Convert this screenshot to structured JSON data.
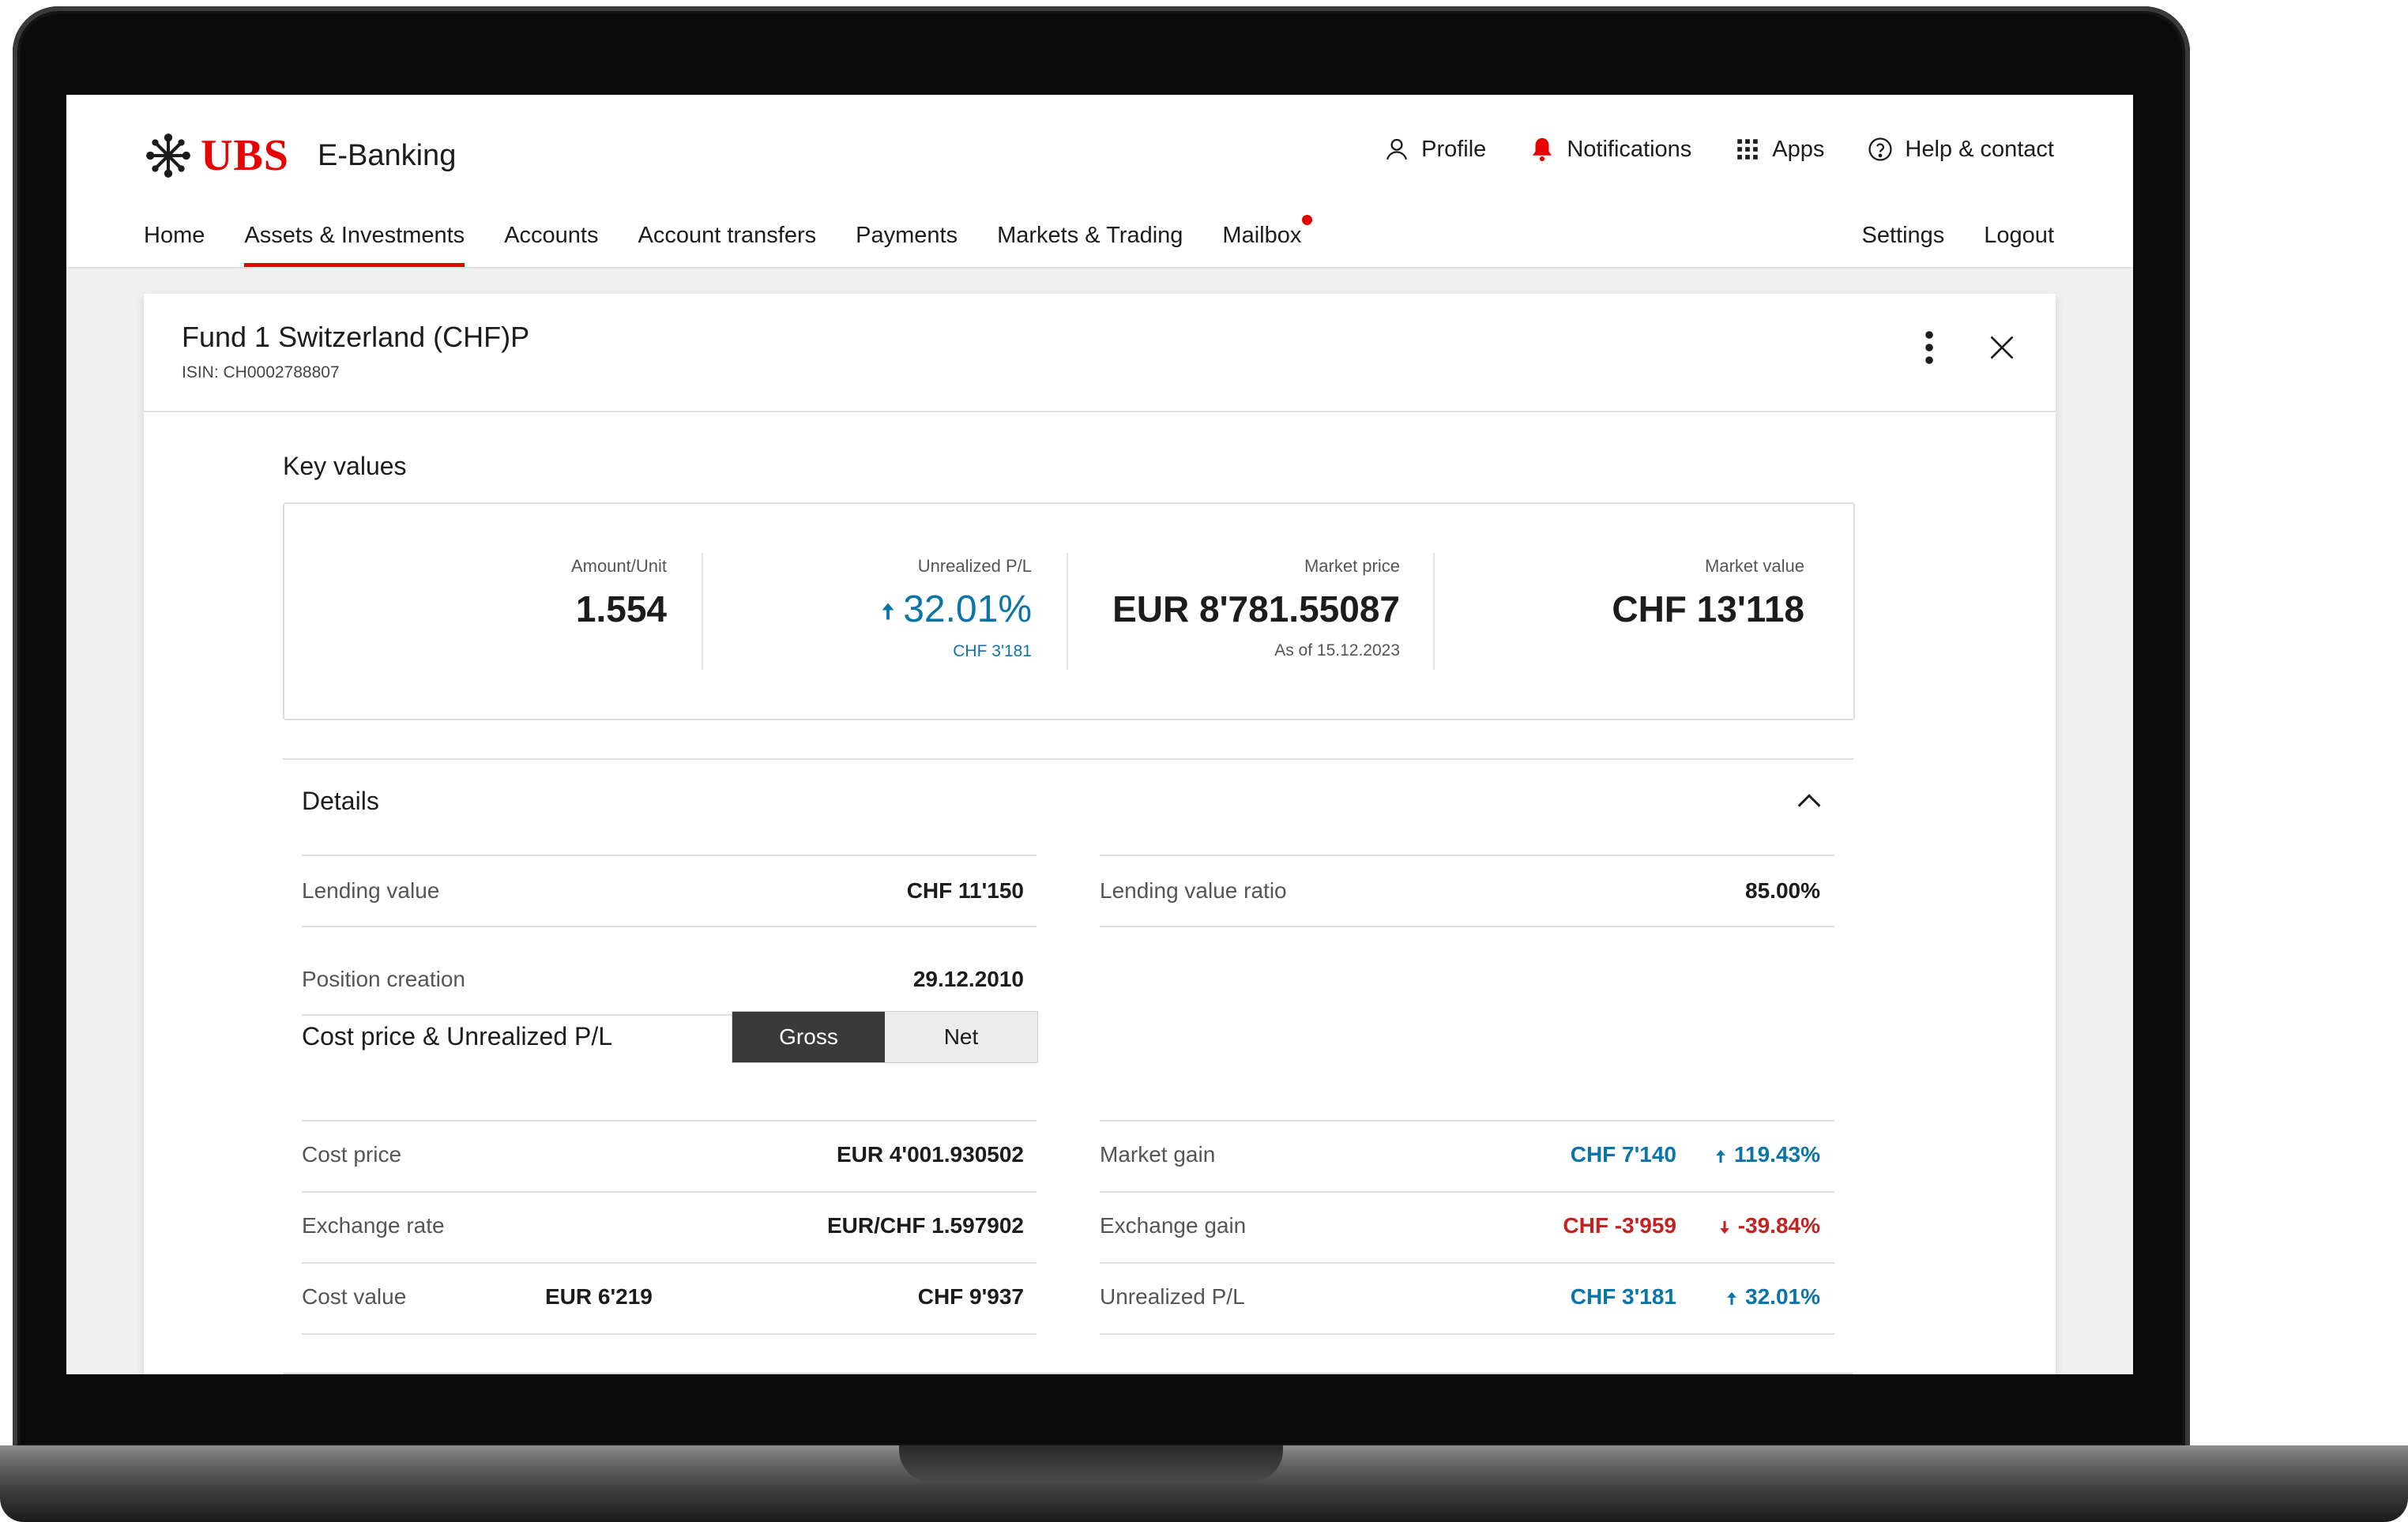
{
  "header": {
    "logo_text": "UBS",
    "app_name": "E-Banking",
    "top_links": [
      "Profile",
      "Notifications",
      "Apps",
      "Help & contact"
    ],
    "nav": [
      "Home",
      "Assets & Investments",
      "Accounts",
      "Account transfers",
      "Payments",
      "Markets & Trading",
      "Mailbox"
    ],
    "nav_active": "Assets & Investments",
    "nav_right": [
      "Settings",
      "Logout"
    ]
  },
  "panel": {
    "title": "Fund 1 Switzerland (CHF)P",
    "isin": "ISIN: CH0002788807",
    "key_values_title": "Key values",
    "key_values": {
      "amount_label": "Amount/Unit",
      "amount_value": "1.554",
      "pl_label": "Unrealized P/L",
      "pl_value": "32.01%",
      "pl_sub": "CHF 3'181",
      "price_label": "Market price",
      "price_value": "EUR 8'781.55087",
      "price_sub": "As of 15.12.2023",
      "mvalue_label": "Market value",
      "mvalue_value": "CHF 13'118"
    },
    "details_title": "Details",
    "details": {
      "lending_value_label": "Lending value",
      "lending_value": "CHF 11'150",
      "lending_ratio_label": "Lending value ratio",
      "lending_ratio": "85.00%",
      "position_creation_label": "Position creation",
      "position_creation": "29.12.2010",
      "cost_section_label": "Cost price & Unrealized P/L",
      "toggle_gross": "Gross",
      "toggle_net": "Net",
      "cost_price_label": "Cost price",
      "cost_price": "EUR 4'001.930502",
      "exchange_rate_label": "Exchange rate",
      "exchange_rate": "EUR/CHF 1.597902",
      "cost_value_label": "Cost value",
      "cost_value_eur": "EUR 6'219",
      "cost_value_chf": "CHF 9'937",
      "market_gain_label": "Market gain",
      "market_gain_chf": "CHF 7'140",
      "market_gain_pct": "119.43%",
      "exchange_gain_label": "Exchange gain",
      "exchange_gain_chf": "CHF -3'959",
      "exchange_gain_pct": "-39.84%",
      "unrealized_pl_label": "Unrealized P/L",
      "unrealized_pl_chf": "CHF 3'181",
      "unrealized_pl_pct": "32.01%"
    }
  },
  "colors": {
    "brand_red": "#e60000",
    "positive_blue": "#0b74a8",
    "negative_red": "#c42121"
  },
  "icons": [
    "ubs-keys-logo",
    "person-icon",
    "bell-icon",
    "grid-icon",
    "help-circle-icon",
    "kebab-icon",
    "close-icon",
    "chevron-up-icon",
    "arrow-up-icon",
    "arrow-down-icon"
  ]
}
